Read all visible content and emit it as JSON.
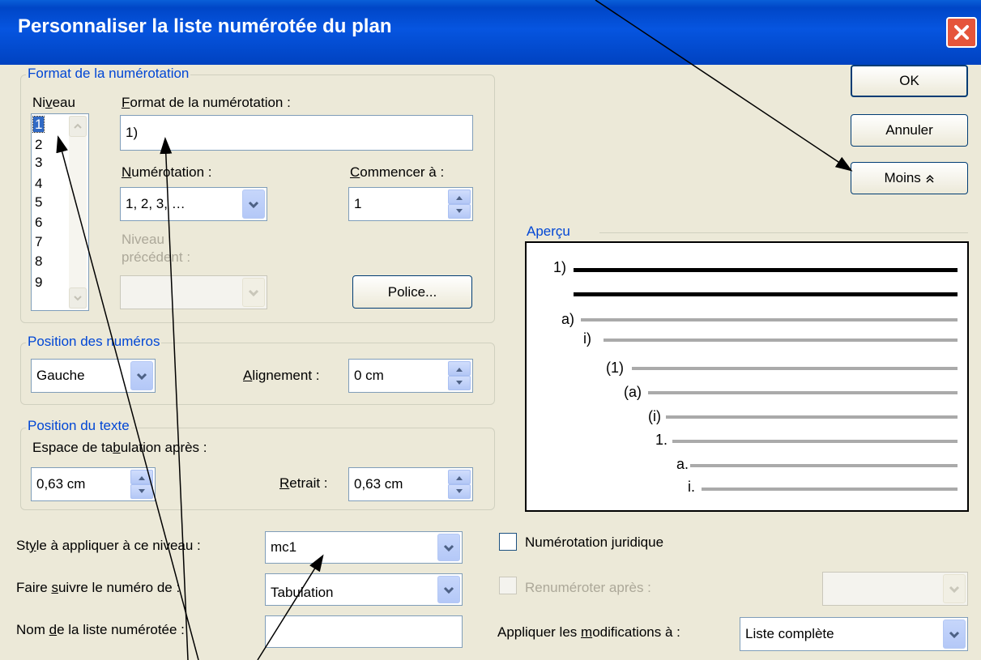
{
  "window": {
    "title": "Personnaliser la liste numérotée du plan"
  },
  "format_group": {
    "label": "Format de la numérotation",
    "niveau_label": "Niveau",
    "levels": [
      "1",
      "2",
      "3",
      "4",
      "5",
      "6",
      "7",
      "8",
      "9"
    ],
    "selected_level": "1",
    "format_label": "Format de la numérotation :",
    "format_value": "1)",
    "numerotation_label": "Numérotation :",
    "numerotation_value": "1, 2, 3, …",
    "commencer_label": "Commencer à :",
    "commencer_value": "1",
    "niveau_precedent_label_1": "Niveau",
    "niveau_precedent_label_2": "précédent :",
    "police_button": "Police..."
  },
  "position_numeros": {
    "label": "Position des numéros",
    "align_value": "Gauche",
    "alignement_label": "Alignement :",
    "alignement_value": "0 cm"
  },
  "position_texte": {
    "label": "Position du texte",
    "tab_label": "Espace de tabulation après :",
    "tab_value": "0,63 cm",
    "retrait_label": "Retrait :",
    "retrait_value": "0,63 cm"
  },
  "bottom": {
    "style_label": "Style à appliquer à ce niveau :",
    "style_value": "mc1",
    "suivre_label": "Faire suivre le numéro de :",
    "suivre_value": "Tabulation",
    "nom_label": "Nom de la liste numérotée :",
    "nom_value": "",
    "juridique_label": "Numérotation juridique",
    "renumeroter_label": "Renuméroter après :",
    "appliquer_label": "Appliquer les modifications à :",
    "appliquer_value": "Liste complète"
  },
  "buttons": {
    "ok": "OK",
    "annuler": "Annuler",
    "moins": "Moins"
  },
  "preview": {
    "label": "Aperçu",
    "numbers": [
      "1)",
      "a)",
      "i)",
      "(1)",
      "(a)",
      "(i)",
      "1.",
      "a.",
      "i."
    ]
  },
  "colors": {
    "title_bar": "#0046c7",
    "group_label": "#0046d5",
    "dialog_bg": "#ece9d8"
  }
}
